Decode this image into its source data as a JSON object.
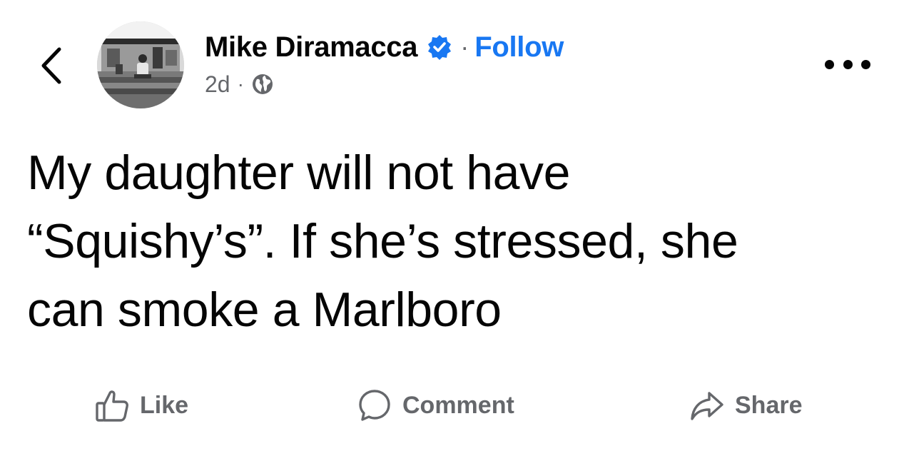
{
  "navigation": {
    "back_icon": "chevron-left-icon"
  },
  "post": {
    "author_name": "Mike Diramacca",
    "verified_icon": "verified-badge-icon",
    "separator": "·",
    "follow_label": "Follow",
    "timestamp": "2d",
    "meta_separator": "·",
    "audience_icon": "globe-icon",
    "more_icon": "more-options-icon",
    "text": "My daughter will not have\n“Squishy’s”. If she’s stressed, she\ncan smoke a Marlboro"
  },
  "actions": {
    "like_label": "Like",
    "comment_label": "Comment",
    "share_label": "Share"
  },
  "colors": {
    "accent": "#1877f2",
    "text_primary": "#050505",
    "text_secondary": "#65676b",
    "background": "#ffffff"
  }
}
